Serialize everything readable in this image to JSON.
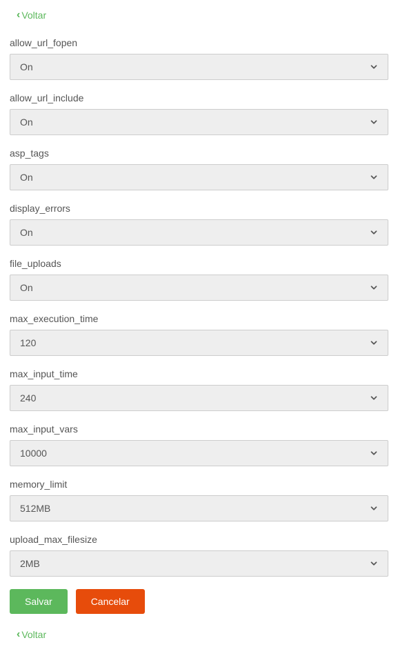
{
  "nav": {
    "back_label": "Voltar"
  },
  "fields": [
    {
      "label": "allow_url_fopen",
      "value": "On"
    },
    {
      "label": "allow_url_include",
      "value": "On"
    },
    {
      "label": "asp_tags",
      "value": "On"
    },
    {
      "label": "display_errors",
      "value": "On"
    },
    {
      "label": "file_uploads",
      "value": "On"
    },
    {
      "label": "max_execution_time",
      "value": "120"
    },
    {
      "label": "max_input_time",
      "value": "240"
    },
    {
      "label": "max_input_vars",
      "value": "10000"
    },
    {
      "label": "memory_limit",
      "value": "512MB"
    },
    {
      "label": "upload_max_filesize",
      "value": "2MB"
    }
  ],
  "buttons": {
    "save": "Salvar",
    "cancel": "Cancelar"
  }
}
